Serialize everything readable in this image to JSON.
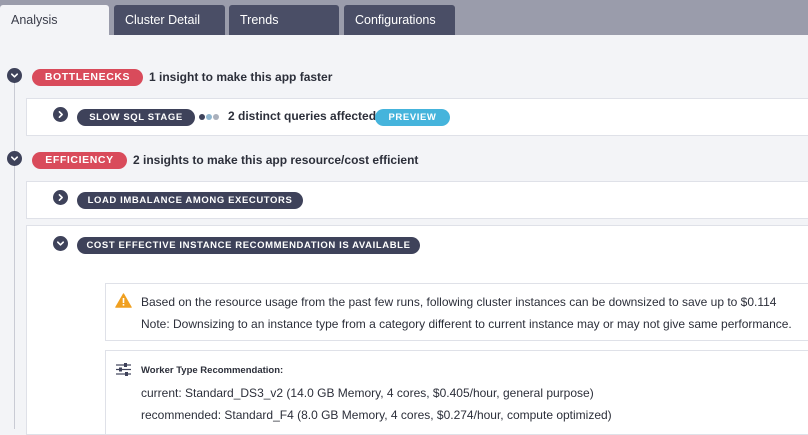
{
  "tabs": [
    {
      "label": "Analysis",
      "active": true
    },
    {
      "label": "Cluster Detail",
      "active": false
    },
    {
      "label": "Trends",
      "active": false
    },
    {
      "label": "Configurations",
      "active": false
    }
  ],
  "sections": {
    "bottlenecks": {
      "badge": "BOTTLENECKS",
      "summary": "1 insight to make this app faster",
      "items": {
        "slow_sql": {
          "label": "SLOW SQL STAGE",
          "detail": "2 distinct queries affected",
          "preview": "PREVIEW"
        }
      }
    },
    "efficiency": {
      "badge": "EFFICIENCY",
      "summary": "2 insights to make this app resource/cost efficient",
      "items": {
        "load_imbalance": {
          "label": "LOAD IMBALANCE AMONG EXECUTORS"
        },
        "cost_effective": {
          "label": "COST EFFECTIVE INSTANCE RECOMMENDATION IS AVAILABLE",
          "warning_line1": "Based on the resource usage from the past few runs, following cluster instances can be downsized to save up to $0.114",
          "warning_line2": "Note: Downsizing to an instance type from a category different to current instance may or may not give same performance.",
          "worker_title": "Worker Type Recommendation:",
          "current": "current: Standard_DS3_v2 (14.0 GB Memory, 4 cores, $0.405/hour, general purpose)",
          "recommended": "recommended: Standard_F4 (8.0 GB Memory, 4 cores, $0.274/hour, compute optimized)"
        }
      }
    }
  },
  "colors": {
    "tab_bg": "#4a4e66",
    "tabbar": "#9a9cab",
    "badge_red": "#d94b5b",
    "pill_dark": "#3e425a",
    "preview_blue": "#45b4dc",
    "warning_orange": "#f0a020"
  },
  "icons": [
    "chevron-down-icon",
    "chevron-right-icon",
    "warning-icon",
    "sliders-icon",
    "progress-dots-icon"
  ]
}
